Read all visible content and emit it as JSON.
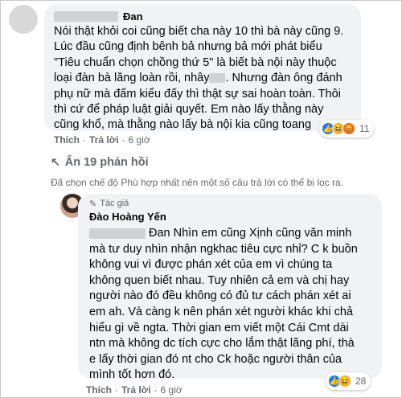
{
  "comment1": {
    "author_suffix": "Đan",
    "text_lines": [
      "Nói thật khỏi coi cũng biết cha này 10 thì bà này cũng 9.",
      "Lúc đầu cũng định bênh bả nhưng bả mới phát biểu",
      "\"Tiêu chuẩn chọn chồng thứ 5\" là biết bà nội này thuộc",
      "loại đàn bà lăng loàn rồi, nhây",
      "phụ nữ mà đấm kiểu đấy thì thật sự sai hoàn toàn. Thôi",
      "thì cứ để pháp luật giải quyết. Em nào lấy thằng này",
      "cũng khổ, mà thằng nào lấy bà nội kia cũng toang"
    ],
    "line4_tail": ". Nhưng đàn ông đánh",
    "reaction_count": "11",
    "actions": {
      "like": "Thích",
      "reply": "Trả lời",
      "time": "6 giờ"
    }
  },
  "replies_toggle": "Ẩn 19 phản hồi",
  "filter_note": "Đã chọn chế độ Phù hợp nhất nên một số câu trả lời có thể bị lọc ra.",
  "reply": {
    "badge": "Tác giả",
    "author": "Đào Hoàng Yến",
    "line1_tail": "Đan Nhìn em cũng Xịnh cũng văn minh",
    "text_lines": [
      "mà tư duy nhìn nhận ngkhac tiêu cực nhỉ? C k buồn",
      "không vui vì được phán xét của em vì chúng ta",
      "không quen biết nhau. Tuy nhiên cả em và chị hay",
      "người nào đó đều không có đủ tư cách phán xét ai",
      "em ah. Và càng k nên phán xét người khác khi chả",
      "hiểu gì về ngta. Thời gian em viết một Cái Cmt dài",
      "ntn mà không dc tích cực cho lắm thật lãng phí, thà",
      "e lấy thời gian đó nt cho Ck hoặc người thân của",
      "mình tốt hơn đó."
    ],
    "reaction_count": "28",
    "actions": {
      "like": "Thích",
      "reply": "Trả lời",
      "time": "6 giờ"
    }
  }
}
